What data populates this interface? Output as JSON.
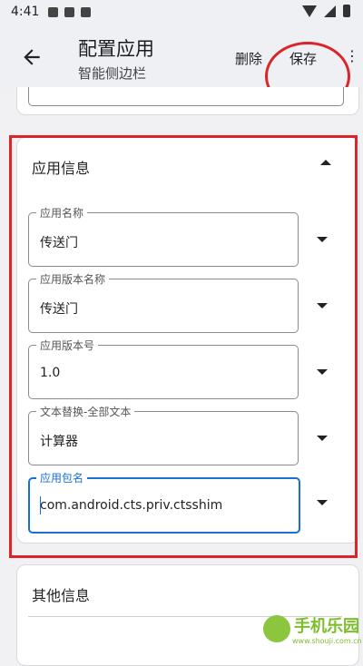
{
  "status_bar": {
    "time": "4:41"
  },
  "app_bar": {
    "title": "配置应用",
    "subtitle": "智能侧边栏",
    "delete_label": "删除",
    "save_label": "保存"
  },
  "app_info": {
    "title": "应用信息",
    "fields": [
      {
        "label": "应用名称",
        "value": "传送门"
      },
      {
        "label": "应用版本名称",
        "value": "传送门"
      },
      {
        "label": "应用版本号",
        "value": "1.0"
      },
      {
        "label": "文本替换-全部文本",
        "value": "计算器"
      },
      {
        "label": "应用包名",
        "value": "com.android.cts.priv.ctsshim"
      }
    ]
  },
  "other_info": {
    "title": "其他信息"
  },
  "watermark": {
    "text": "手机乐园",
    "url": "www.shouji.com.cn"
  },
  "colors": {
    "highlight": "#d8262a",
    "focus": "#1a6fd6"
  }
}
